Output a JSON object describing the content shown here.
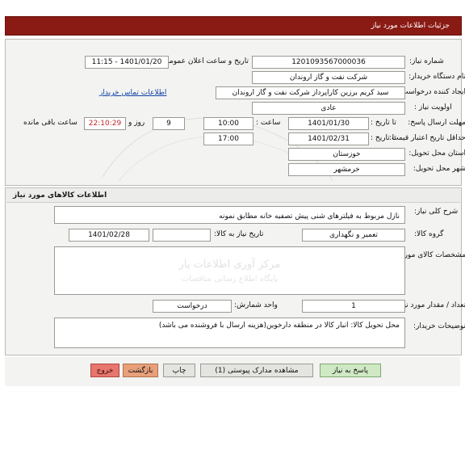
{
  "window": {
    "title": "جزئیات اطلاعات مورد نیاز"
  },
  "section1": {
    "heading": "",
    "fields": {
      "req_number_label": "شماره نیاز:",
      "req_number_value": "1201093567000036",
      "announce_date_label": "تاریخ و ساعت اعلان عمومی:",
      "announce_date_value": "1401/01/20 - 11:15",
      "buyer_org_label": "نام دستگاه خریدار:",
      "buyer_org_value": "شرکت نفت و گاز اروندان",
      "requester_label": "ایجاد کننده درخواست:",
      "requester_value": "سید کریم برزین کاراپرداز شرکت نفت و گاز اروندان",
      "contact_link": "اطلاعات تماس خریدار",
      "priority_label": "اولویت نیاز :",
      "priority_value": "عادی",
      "reply_deadline_label": "مهلت ارسال پاسخ:",
      "reply_until_label": "تا تاریخ :",
      "reply_until_date": "1401/01/30",
      "reply_hour_label": "ساعت :",
      "reply_hour_value": "10:00",
      "remaining_days_value": "9",
      "remaining_text": "روز و",
      "remaining_timer": "22:10:29",
      "remaining_suffix": "ساعت باقی مانده",
      "credit_deadline_label": "حداقل تاریخ اعتبار قیمت:",
      "credit_until_label": "تا تاریخ :",
      "credit_until_date": "1401/02/31",
      "credit_hour_value": "17:00",
      "province_label": "استان محل تحویل:",
      "province_value": "خوزستان",
      "city_label": "شهر محل تحویل:",
      "city_value": "خرمشهر"
    }
  },
  "section2": {
    "heading": "اطلاعات کالاهای مورد نیاز",
    "fields": {
      "general_desc_label": "شرح کلی نیاز:",
      "general_desc_value": "نازل مربوط به فیلترهای شنی پیش تصفیه خانه مطابق نمونه",
      "group_label": "گروه کالا:",
      "group_value": "تعمیر و نگهداری",
      "need_date_label": "تاریخ نیاز به کالا:",
      "need_date_value": "1401/02/28",
      "specs_label": "مشخصات کالای مورد نیاز:",
      "specs_value": "",
      "watermark_line1": "مرکز آوری اطلاعات یار",
      "watermark_line2": "پایگاه اطلاع رسانی مناقصات",
      "qty_label": "تعداد / مقدار مورد نیاز:",
      "qty_value": "1",
      "unit_label": "واحد شمارش:",
      "unit_value": "درخواست",
      "buyer_notes_label": "توضیحات خریدار:",
      "buyer_notes_value": "محل تحویل کالا: انبار کالا در منطقه دارخوین(هزینه ارسال با فروشنده می باشد)"
    }
  },
  "footer": {
    "buttons": [
      {
        "label": "خروج",
        "style": "red",
        "name": "exit-button"
      },
      {
        "label": "بازگشت",
        "style": "orange",
        "name": "back-button"
      },
      {
        "label": "چاپ",
        "style": "grey",
        "name": "print-button"
      },
      {
        "label": "مشاهده مدارک پیوستی (1)",
        "style": "grey",
        "name": "view-attachments-button"
      },
      {
        "label": "پاسخ به نیاز",
        "style": "green",
        "name": "respond-to-need-button"
      }
    ]
  }
}
